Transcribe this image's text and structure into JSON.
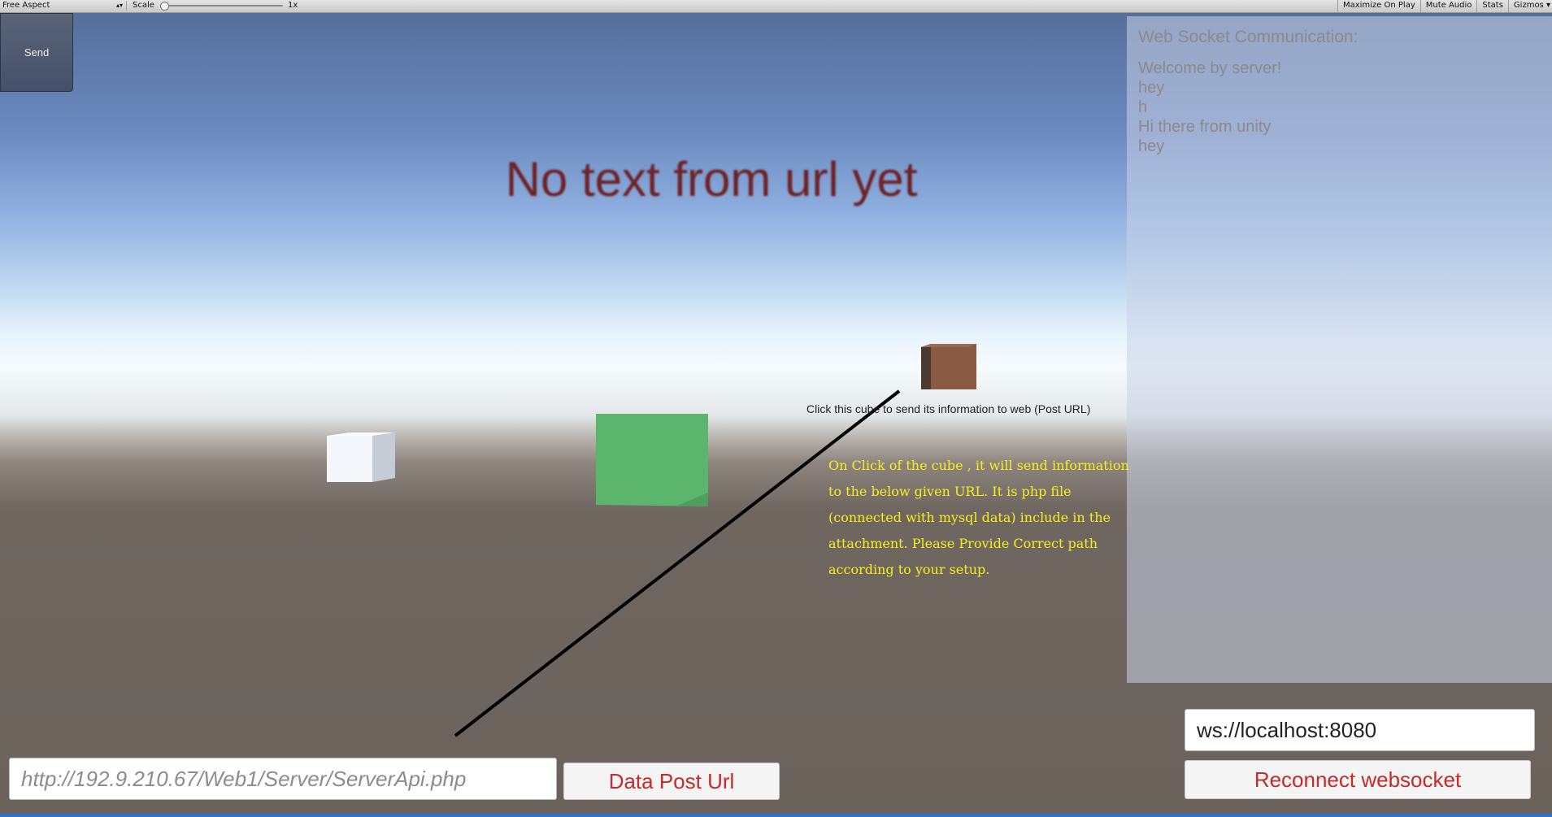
{
  "toolbar": {
    "aspect": "Free Aspect",
    "scale_label": "Scale",
    "scale_value": "1x",
    "maximize_on_play": "Maximize On Play",
    "mute_audio": "Mute Audio",
    "stats": "Stats",
    "gizmos": "Gizmos"
  },
  "send_button": "Send",
  "url_text": "No text from url yet",
  "websocket_panel": {
    "title": "Web Socket Communication:",
    "messages": [
      "Welcome by server!",
      "hey",
      "h",
      "Hi there from unity",
      "hey"
    ]
  },
  "cube_caption": "Click this cube to send its information to web (Post URL)",
  "note_lines": [
    "On Click of the  cube ,  it will send information",
    "to the below given URL. It  is  php file",
    "(connected with mysql data)  include in the",
    "attachment. Please Provide Correct path",
    "according to your setup."
  ],
  "post_url_input": {
    "value": "http://192.9.210.67/Web1/Server/ServerApi.php"
  },
  "data_post_button": "Data Post Url",
  "ws_url_input": {
    "value": "ws://localhost:8080"
  },
  "reconnect_button": "Reconnect websocket",
  "colors": {
    "button_text": "#c62a2a",
    "note_text": "#f4f01e",
    "url_text": "#6e2225",
    "white_cube": "#f3f6fa",
    "green_cube": "#5cb56c",
    "brown_cube": "#8a5a43"
  }
}
